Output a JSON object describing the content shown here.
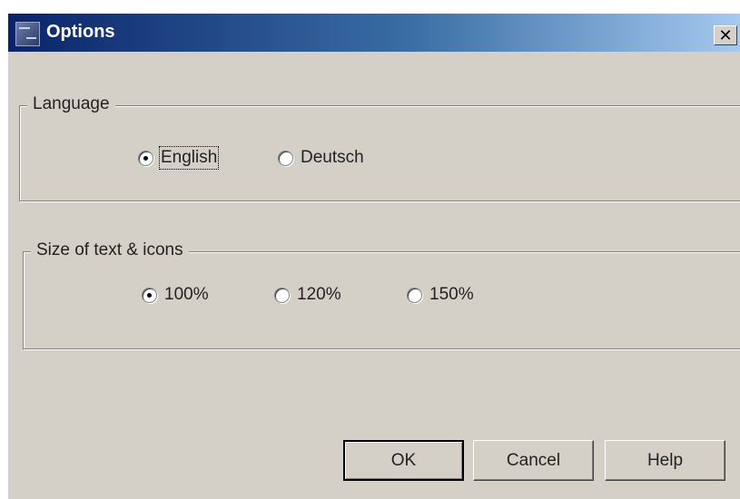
{
  "window": {
    "title": "Options",
    "close_label": "✕"
  },
  "language_group": {
    "legend": "Language",
    "options": [
      {
        "label": "English",
        "checked": true
      },
      {
        "label": "Deutsch",
        "checked": false
      }
    ]
  },
  "size_group": {
    "legend": "Size of text & icons",
    "options": [
      {
        "label": "100%",
        "checked": true
      },
      {
        "label": "120%",
        "checked": false
      },
      {
        "label": "150%",
        "checked": false
      }
    ]
  },
  "buttons": {
    "ok": "OK",
    "cancel": "Cancel",
    "help": "Help"
  }
}
